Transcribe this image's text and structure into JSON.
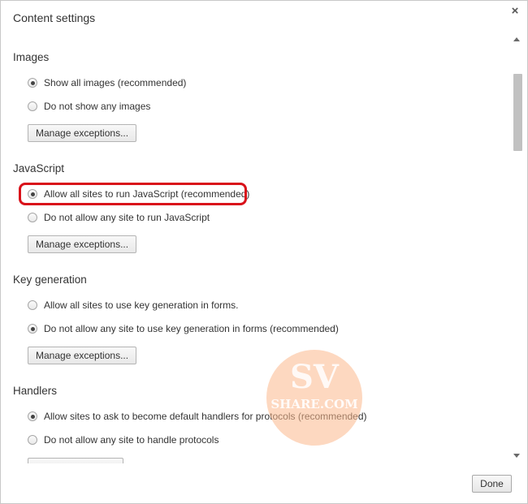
{
  "dialog": {
    "title": "Content settings",
    "close_icon": "close-icon",
    "close_glyph": "×",
    "done_label": "Done"
  },
  "sections": {
    "images": {
      "title": "Images",
      "options": [
        {
          "label": "Show all images (recommended)",
          "checked": true
        },
        {
          "label": "Do not show any images",
          "checked": false
        }
      ],
      "button": "Manage exceptions..."
    },
    "javascript": {
      "title": "JavaScript",
      "options": [
        {
          "label": "Allow all sites to run JavaScript (recommended)",
          "checked": true
        },
        {
          "label": "Do not allow any site to run JavaScript",
          "checked": false
        }
      ],
      "button": "Manage exceptions..."
    },
    "keygen": {
      "title": "Key generation",
      "options": [
        {
          "label": "Allow all sites to use key generation in forms.",
          "checked": false
        },
        {
          "label": "Do not allow any site to use key generation in forms (recommended)",
          "checked": true
        }
      ],
      "button": "Manage exceptions..."
    },
    "handlers": {
      "title": "Handlers",
      "options": [
        {
          "label": "Allow sites to ask to become default handlers for protocols (recommended)",
          "checked": true
        },
        {
          "label": "Do not allow any site to handle protocols",
          "checked": false
        }
      ]
    }
  },
  "highlight_color": "#d9111a",
  "watermark": {
    "text_large": "SV",
    "text_small": "SHARE.COM"
  }
}
